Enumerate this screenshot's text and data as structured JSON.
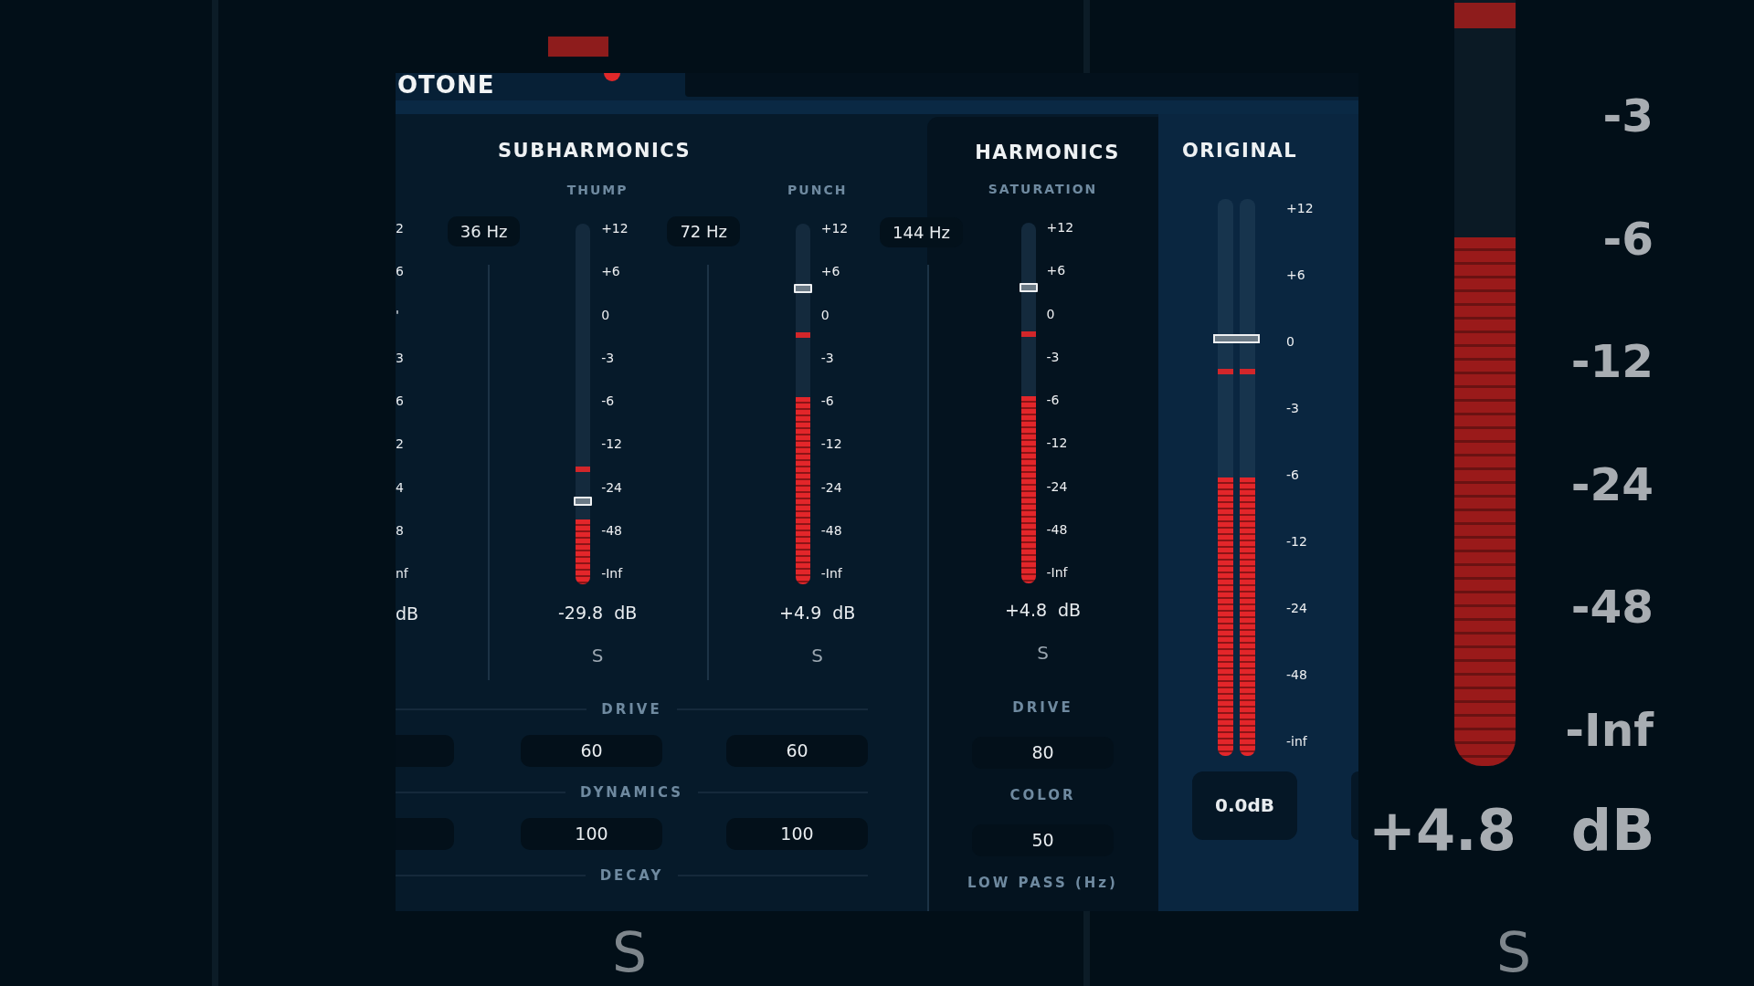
{
  "backdrop": {
    "meter": {
      "level": 0.69
    },
    "peak": {
      "level": 0.98
    },
    "scale": [
      "-3",
      "-6",
      "-12",
      "-24",
      "-48",
      "-Inf"
    ],
    "reading": "+4.8",
    "unit": "dB",
    "solo": [
      "S",
      "S"
    ]
  },
  "header": {
    "logo": "OTONE"
  },
  "subharmonics": {
    "title": "SUBHARMONICS",
    "partial_column": {
      "scale": [
        "2",
        "6",
        "'",
        "3",
        "6",
        "2",
        "4",
        "8",
        "nf"
      ],
      "unit": "dB"
    },
    "crossovers": [
      "36 Hz",
      "72 Hz"
    ],
    "bands": [
      {
        "name": "THUMP",
        "meter": {
          "level": 0.18
        },
        "peak": {
          "level": 0.32
        },
        "fader": {
          "level": 0.23
        },
        "scale": [
          "+12",
          "+6",
          "0",
          "-3",
          "-6",
          "-12",
          "-24",
          "-48",
          "-Inf"
        ],
        "reading": "-29.8",
        "unit": "dB",
        "solo": "S"
      },
      {
        "name": "PUNCH",
        "meter": {
          "level": 0.52
        },
        "peak": {
          "level": 0.69
        },
        "fader": {
          "level": 0.82
        },
        "scale": [
          "+12",
          "+6",
          "0",
          "-3",
          "-6",
          "-12",
          "-24",
          "-48",
          "-Inf"
        ],
        "reading": "+4.9",
        "unit": "dB",
        "solo": "S"
      }
    ],
    "controls": [
      {
        "label": "DRIVE",
        "values": [
          "60",
          "60"
        ]
      },
      {
        "label": "DYNAMICS",
        "values": [
          "100",
          "100"
        ]
      },
      {
        "label": "DECAY"
      }
    ]
  },
  "harmonics": {
    "title": "HARMONICS",
    "crossover": "144 Hz",
    "band": {
      "name": "SATURATION",
      "meter": {
        "level": 0.52
      },
      "peak": {
        "level": 0.69
      },
      "fader": {
        "level": 0.82
      },
      "scale": [
        "+12",
        "+6",
        "0",
        "-3",
        "-6",
        "-12",
        "-24",
        "-48",
        "-Inf"
      ],
      "reading": "+4.8",
      "unit": "dB",
      "solo": "S"
    },
    "controls": [
      {
        "label": "DRIVE",
        "value": "80"
      },
      {
        "label": "COLOR",
        "value": "50"
      },
      {
        "label": "LOW PASS (Hz)"
      }
    ]
  },
  "original": {
    "title": "ORIGINAL",
    "meters": [
      {
        "fill": {
          "level": 0.5
        },
        "peak": {
          "level": 0.69
        }
      },
      {
        "fill": {
          "level": 0.5
        },
        "peak": {
          "level": 0.69
        }
      }
    ],
    "fader": {
      "level": 0.75
    },
    "scale": [
      "+12",
      "+6",
      "0",
      "-3",
      "-6",
      "-12",
      "-24",
      "-48",
      "-inf"
    ],
    "reading": "0.0dB"
  }
}
